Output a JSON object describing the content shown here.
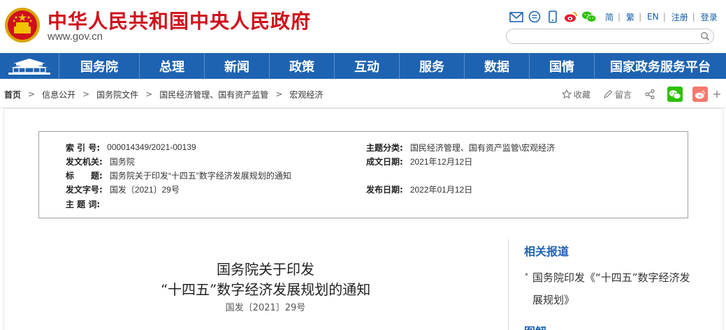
{
  "header": {
    "site_title": "中华人民共和国中央人民政府",
    "site_domain": "www.gov.cn",
    "lang_links": [
      "简",
      "繁",
      "EN",
      "注册",
      "登录"
    ],
    "search_placeholder": ""
  },
  "nav": {
    "items": [
      "国务院",
      "总理",
      "新闻",
      "政策",
      "互动",
      "服务",
      "数据",
      "国情",
      "国家政务服务平台"
    ]
  },
  "breadcrumb": {
    "items": [
      "首页",
      "信息公开",
      "国务院文件",
      "国民经济管理、国有资产监管",
      "宏观经济"
    ]
  },
  "actions": {
    "favorite": "收藏",
    "comment": "留言"
  },
  "info": {
    "index_label": "索 引 号:",
    "index_value": "000014349/2021-00139",
    "category_label": "主题分类:",
    "category_value": "国民经济管理、国有资产监管\\宏观经济",
    "issuer_label": "发文机关:",
    "issuer_value": "国务院",
    "created_label": "成文日期:",
    "created_value": "2021年12月12日",
    "title_label": "标　　题:",
    "title_value": "国务院关于印发“十四五”数字经济发展规划的通知",
    "docno_label": "发文字号:",
    "docno_value": "国发〔2021〕29号",
    "published_label": "发布日期:",
    "published_value": "2022年01月12日",
    "subject_label": "主 题 词:",
    "subject_value": ""
  },
  "article": {
    "title_line1": "国务院关于印发",
    "title_line2": "“十四五”数字经济发展规划的通知",
    "doc_number": "国发〔2021〕29号"
  },
  "sidebar": {
    "related_heading": "相关报道",
    "related_link": "国务院印发《“十四五”数字经济发展规划》",
    "next_heading": "图解"
  },
  "colors": {
    "brand_red": "#d0101b",
    "nav_blue": "#1e63b1",
    "wechat_green": "#2dc100",
    "weibo_red": "#e6162d"
  }
}
